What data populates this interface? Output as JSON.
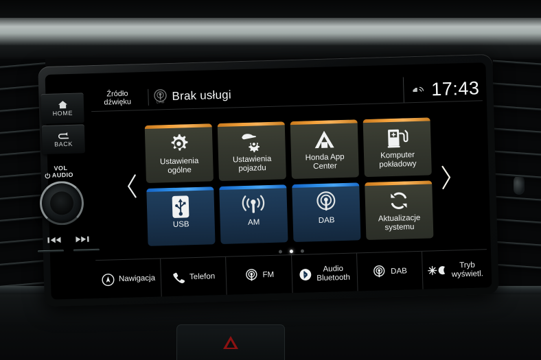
{
  "device": {
    "brand": "Honda",
    "screen_name": "infotainment-head-unit"
  },
  "hardware_buttons": [
    {
      "id": "home",
      "label": "HOME",
      "icon": "house-icon"
    },
    {
      "id": "back",
      "label": "BACK",
      "icon": "back-arrow-icon"
    }
  ],
  "volume_knob": {
    "line1": "VOL",
    "line2": "AUDIO",
    "icon": "power-icon"
  },
  "transport": {
    "prev_icon": "previous-track-icon",
    "next_icon": "next-track-icon"
  },
  "status_bar": {
    "source_line1": "Źródło",
    "source_line2": "dźwięku",
    "source_icon": "dab-radio-icon",
    "title": "Brak usługi",
    "connectivity_icon": "car-wifi-icon",
    "clock": "17:43"
  },
  "navigation": {
    "prev_page_icon": "chevron-left-icon",
    "next_page_icon": "chevron-right-icon",
    "page_count": 3,
    "active_page": 2
  },
  "tiles": [
    {
      "id": "ustawienia-ogolne",
      "label": "Ustawienia\nogólne",
      "label_l1": "Ustawienia",
      "label_l2": "ogólne",
      "theme": "orange",
      "icon": "gear-icon",
      "accent": "#f2a03a"
    },
    {
      "id": "ustawienia-pojazdu",
      "label": "Ustawienia\npojazdu",
      "label_l1": "Ustawienia",
      "label_l2": "pojazdu",
      "theme": "orange",
      "icon": "car-gear-icon",
      "accent": "#f2a03a"
    },
    {
      "id": "honda-app-center",
      "label": "Honda App\nCenter",
      "label_l1": "Honda App",
      "label_l2": "Center",
      "theme": "orange",
      "icon": "honda-a-icon",
      "accent": "#f2a03a"
    },
    {
      "id": "komputer-pokladowy",
      "label": "Komputer\npokładowy",
      "label_l1": "Komputer",
      "label_l2": "pokładowy",
      "theme": "orange",
      "icon": "fuel-pump-icon",
      "accent": "#f2a03a"
    },
    {
      "id": "usb",
      "label": "USB",
      "label_l1": "USB",
      "label_l2": "",
      "theme": "blue",
      "icon": "usb-icon",
      "accent": "#2f90e8"
    },
    {
      "id": "am",
      "label": "AM",
      "label_l1": "AM",
      "label_l2": "",
      "theme": "blue",
      "icon": "am-radio-icon",
      "accent": "#2f90e8"
    },
    {
      "id": "dab",
      "label": "DAB",
      "label_l1": "DAB",
      "label_l2": "",
      "theme": "blue",
      "icon": "dab-radio-icon",
      "accent": "#2f90e8"
    },
    {
      "id": "aktualizacje-systemu",
      "label": "Aktualizacje\nsystemu",
      "label_l1": "Aktualizacje",
      "label_l2": "systemu",
      "theme": "orange",
      "icon": "refresh-icon",
      "accent": "#f2a03a"
    }
  ],
  "shortcut_bar": [
    {
      "id": "nawigacja",
      "label_l1": "Nawigacja",
      "label_l2": "",
      "icon": "compass-icon"
    },
    {
      "id": "telefon",
      "label_l1": "Telefon",
      "label_l2": "",
      "icon": "phone-icon"
    },
    {
      "id": "fm",
      "label_l1": "FM",
      "label_l2": "",
      "icon": "radio-waves-icon"
    },
    {
      "id": "audio-bluetooth",
      "label_l1": "Audio",
      "label_l2": "Bluetooth",
      "icon": "bluetooth-icon"
    },
    {
      "id": "dab",
      "label_l1": "DAB",
      "label_l2": "",
      "icon": "radio-waves-icon"
    },
    {
      "id": "tryb-wyswietl",
      "label_l1": "Tryb",
      "label_l2": "wyświetl.",
      "icon": "sun-moon-icon"
    }
  ],
  "dashboard": {
    "hazard_button_icon": "hazard-triangle-icon",
    "left_vent": "air-vent-left",
    "right_vent": "air-vent-right"
  },
  "colors": {
    "accent_orange": "#f2a03a",
    "accent_blue": "#2f90e8",
    "screen_bg": "#000000",
    "text": "#f2f4f4",
    "hazard_red": "#8c1212"
  }
}
